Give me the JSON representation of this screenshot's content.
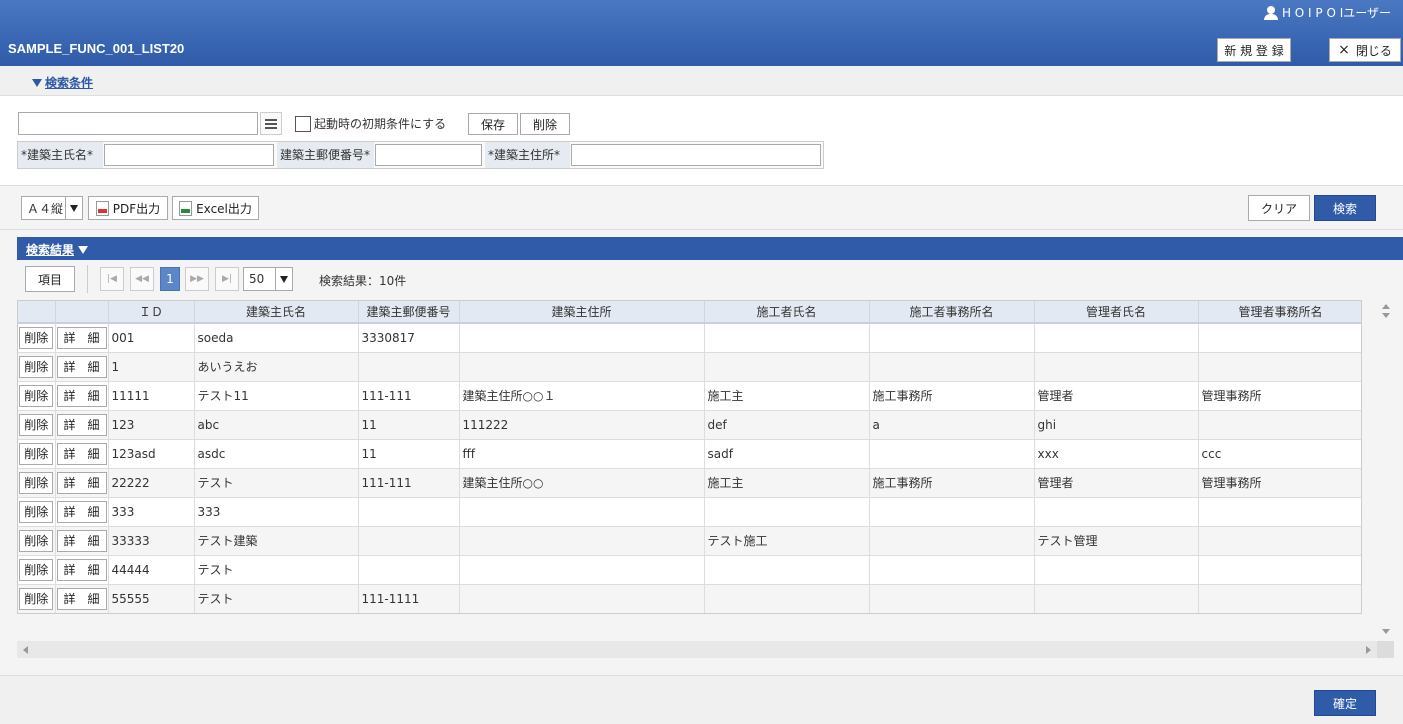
{
  "header": {
    "user": "H O I P O Iユーザー",
    "title": "SAMPLE_FUNC_001_LIST20",
    "new_label": "新 規 登 録",
    "close_label": "閉じる",
    "close_icon": "×"
  },
  "conditions": {
    "toggle_label": "検索条件",
    "preset_value": "",
    "checkbox_label": "起動時の初期条件にする",
    "save_label": "保存",
    "delete_label": "削除",
    "fields": [
      {
        "label": "*建築主氏名*",
        "value": ""
      },
      {
        "label": "建築主郵便番号*",
        "value": ""
      },
      {
        "label": "*建築主住所*",
        "value": ""
      }
    ]
  },
  "toolbar": {
    "paper_size": "Ａ４縦",
    "pdf_label": "PDF出力",
    "excel_label": "Excel出力",
    "clear_label": "クリア",
    "search_label": "検索"
  },
  "results": {
    "toggle_label": "検索結果",
    "items_label": "項目",
    "pager": {
      "first": "|◀",
      "prev": "◀◀",
      "current_page": "1",
      "next": "▶▶",
      "last": "▶|",
      "page_size": "50",
      "count_text": "検索結果：10件"
    },
    "row_delete_label": "削除",
    "row_detail_label": "詳　細",
    "columns": [
      "ＩＤ",
      "建築主氏名",
      "建築主郵便番号",
      "建築主住所",
      "施工者氏名",
      "施工者事務所名",
      "管理者氏名",
      "管理者事務所名"
    ],
    "rows": [
      [
        "001",
        "soeda",
        "3330817",
        "",
        "",
        "",
        "",
        ""
      ],
      [
        "1",
        "あいうえお",
        "",
        "",
        "",
        "",
        "",
        ""
      ],
      [
        "11111",
        "テスト11",
        "111-111",
        "建築主住所○○１",
        "施工主",
        "施工事務所",
        "管理者",
        "管理事務所"
      ],
      [
        "123",
        "abc",
        "11",
        "111222",
        "def",
        "a",
        "ghi",
        ""
      ],
      [
        "123asd",
        "asdc",
        "11",
        "fff",
        "sadf",
        "",
        "xxx",
        "ccc"
      ],
      [
        "22222",
        "テスト",
        "111-111",
        "建築主住所○○",
        "施工主",
        "施工事務所",
        "管理者",
        "管理事務所"
      ],
      [
        "333",
        "333",
        "",
        "",
        "",
        "",
        "",
        ""
      ],
      [
        "33333",
        "テスト建築",
        "",
        "",
        "テスト施工",
        "",
        "テスト管理",
        ""
      ],
      [
        "44444",
        "テスト",
        "",
        "",
        "",
        "",
        "",
        ""
      ],
      [
        "55555",
        "テスト",
        "111-1111",
        "",
        "",
        "",
        "",
        ""
      ]
    ]
  },
  "footer": {
    "confirm_label": "確定"
  }
}
